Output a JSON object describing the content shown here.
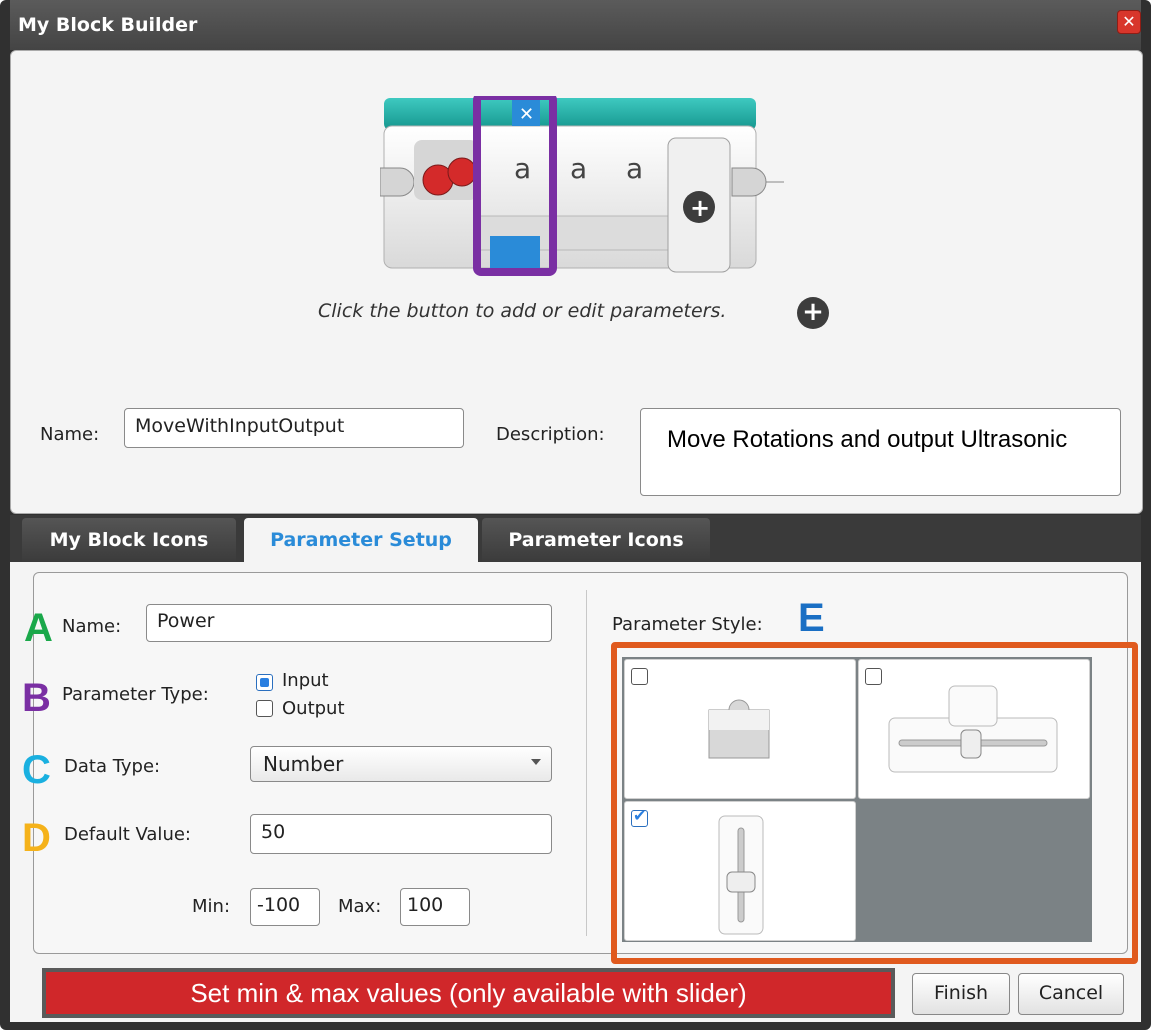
{
  "window": {
    "title": "My Block Builder",
    "close_glyph": "✕"
  },
  "block_preview": {
    "param_letters": [
      "a",
      "a",
      "a"
    ],
    "selected_param_index": 0,
    "delete_glyph": "✕",
    "add_glyph": "+",
    "highlight_color": "#7a2fa3"
  },
  "hint": {
    "text": "Click the button to add or edit parameters.",
    "button_glyph": "+"
  },
  "block_info": {
    "name_label": "Name:",
    "name_value": "MoveWithInputOutput",
    "description_label": "Description:",
    "description_value": "Move Rotations and output Ultrasonic"
  },
  "tabs": [
    {
      "label": "My Block Icons",
      "active": false
    },
    {
      "label": "Parameter Setup",
      "active": true
    },
    {
      "label": "Parameter Icons",
      "active": false
    }
  ],
  "parameter_setup": {
    "name_label": "Name:",
    "name_value": "Power",
    "type_label": "Parameter Type:",
    "type_options": [
      {
        "label": "Input",
        "selected": true
      },
      {
        "label": "Output",
        "selected": false
      }
    ],
    "data_type_label": "Data Type:",
    "data_type_value": "Number",
    "default_label": "Default Value:",
    "default_value": "50",
    "min_label": "Min:",
    "min_value": "-100",
    "max_label": "Max:",
    "max_value": "100"
  },
  "parameter_style": {
    "label": "Parameter Style:",
    "options": [
      {
        "style": "plain",
        "checked": false
      },
      {
        "style": "horizontal-slider",
        "checked": false
      },
      {
        "style": "vertical-slider",
        "checked": true
      }
    ],
    "highlight_color": "#e05a1e"
  },
  "annotations": {
    "letters": [
      {
        "letter": "A",
        "color": "#1aa84a"
      },
      {
        "letter": "B",
        "color": "#7a2fa3"
      },
      {
        "letter": "C",
        "color": "#1ab0e0"
      },
      {
        "letter": "D",
        "color": "#f5b21a"
      },
      {
        "letter": "E",
        "color": "#1a6fc4"
      }
    ],
    "banner_text": "Set min & max values (only available with slider)",
    "banner_color": "#d0272a"
  },
  "buttons": {
    "finish": "Finish",
    "cancel": "Cancel"
  }
}
